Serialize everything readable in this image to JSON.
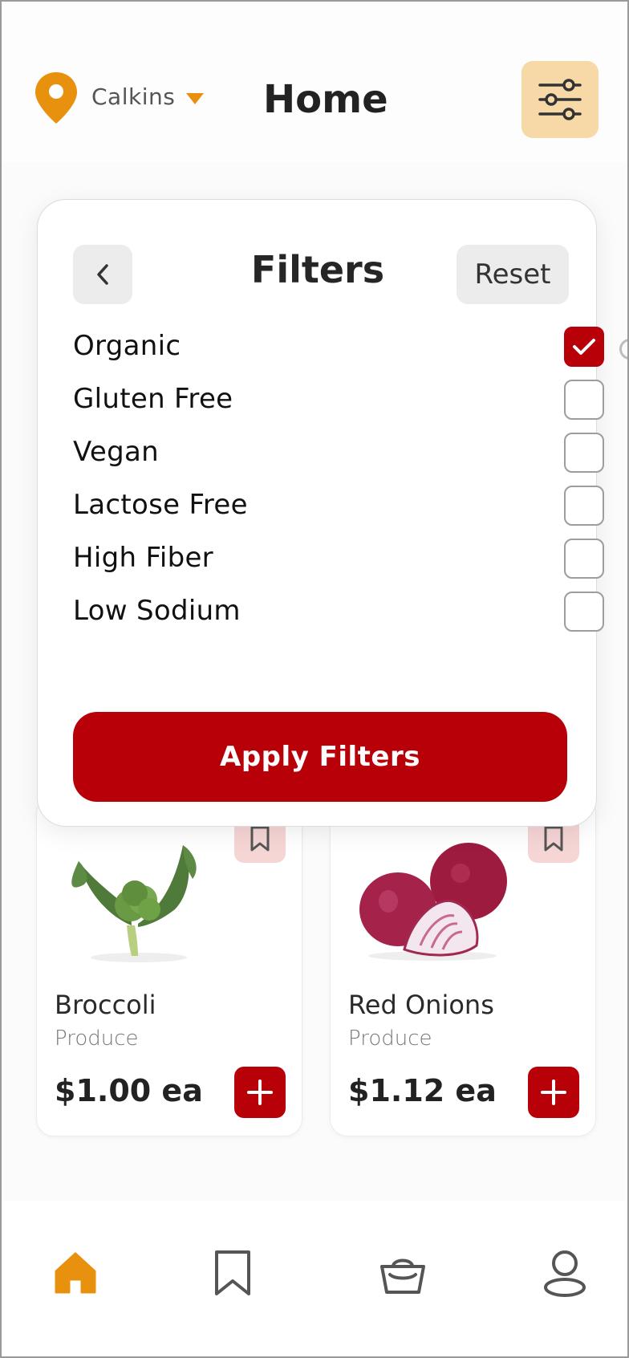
{
  "header": {
    "location": "Calkins",
    "title": "Home",
    "location_icon": "map-pin-icon",
    "filter_icon": "sliders-icon"
  },
  "filters_modal": {
    "title": "Filters",
    "reset_label": "Reset",
    "back_icon": "chevron-left-icon",
    "options": [
      {
        "label": "Organic",
        "checked": true
      },
      {
        "label": "Gluten Free",
        "checked": false
      },
      {
        "label": "Vegan",
        "checked": false
      },
      {
        "label": "Lactose Free",
        "checked": false
      },
      {
        "label": "High Fiber",
        "checked": false
      },
      {
        "label": "Low Sodium",
        "checked": false
      }
    ],
    "apply_label": "Apply Filters"
  },
  "products": [
    {
      "name": "Broccoli",
      "category": "Produce",
      "price": "$1.00 ea"
    },
    {
      "name": "Red Onions",
      "category": "Produce",
      "price": "$1.12 ea"
    }
  ],
  "bottom_nav": [
    {
      "name": "home",
      "icon": "home-icon",
      "active": true
    },
    {
      "name": "saved",
      "icon": "bookmark-icon",
      "active": false
    },
    {
      "name": "basket",
      "icon": "basket-icon",
      "active": false
    },
    {
      "name": "profile",
      "icon": "user-icon",
      "active": false
    }
  ],
  "colors": {
    "accent": "#e8910e",
    "primary_red": "#b80008",
    "filter_button_bg": "#f7d9a8",
    "bookmark_bg": "#f6d5d5"
  }
}
